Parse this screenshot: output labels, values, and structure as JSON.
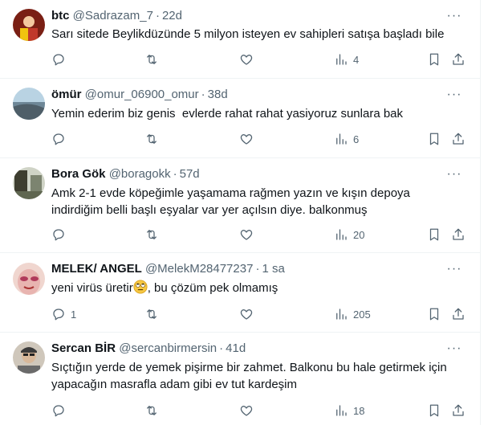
{
  "tweets": [
    {
      "name": "btc",
      "handle": "@Sadrazam_7",
      "time": "22d",
      "text": "Sarı sitede Beylikdüzünde 5 milyon isteyen ev sahipleri satışa başladı bile",
      "replies": "",
      "views": "4",
      "avatar_colors": [
        "#c0392b",
        "#f1c40f"
      ]
    },
    {
      "name": "ömür",
      "handle": "@omur_06900_omur",
      "time": "38d",
      "text": "Yemin ederim biz genis  evlerde rahat rahat yasiyoruz sunlara bak",
      "replies": "",
      "views": "6",
      "avatar_colors": [
        "#8fb3c9",
        "#5b6f7d"
      ]
    },
    {
      "name": "Bora Gök",
      "handle": "@boragokk",
      "time": "57d",
      "text": "Amk 2-1 evde köpeğimle yaşamama rağmen yazın ve kışın depoya\nindirdiğim belli başlı eşyalar var yer açılsın diye. balkonmuş",
      "replies": "",
      "views": "20",
      "avatar_colors": [
        "#4a4a3a",
        "#9aa08a"
      ]
    },
    {
      "name": "MELEK/ ANGEL",
      "handle": "@MelekM28477237",
      "time": "1 sa",
      "text_before": "yeni virüs üretir",
      "text_after": ", bu çözüm pek olmamış",
      "emoji": "rolling-eyes-emoji",
      "replies": "1",
      "views": "205",
      "avatar_colors": [
        "#e8b4b0",
        "#b03a5b"
      ]
    },
    {
      "name": "Sercan BİR",
      "handle": "@sercanbirmersin",
      "time": "41d",
      "text": "Sıçtığın yerde de yemek pişirme bir zahmet. Balkonu bu hale getirmek için\nyapacağın masrafla adam gibi ev tut kardeşim",
      "replies": "",
      "views": "18",
      "avatar_colors": [
        "#9a9a9a",
        "#d8cfc4"
      ]
    }
  ],
  "more_label": "···",
  "dot": "·"
}
